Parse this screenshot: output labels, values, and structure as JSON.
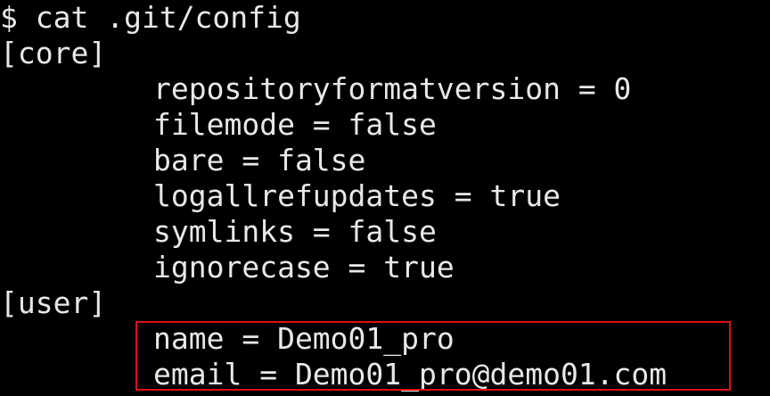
{
  "terminal": {
    "prompt": "$",
    "command": "cat .git/config",
    "lines": [
      "[core]",
      "repositoryformatversion = 0",
      "filemode = false",
      "bare = false",
      "logallrefupdates = true",
      "symlinks = false",
      "ignorecase = true",
      "[user]",
      "name = Demo01_pro",
      "email = Demo01_pro@demo01.com"
    ]
  },
  "colors": {
    "background": "#000000",
    "text": "#e8e8e8",
    "highlight_border": "#e01010"
  }
}
